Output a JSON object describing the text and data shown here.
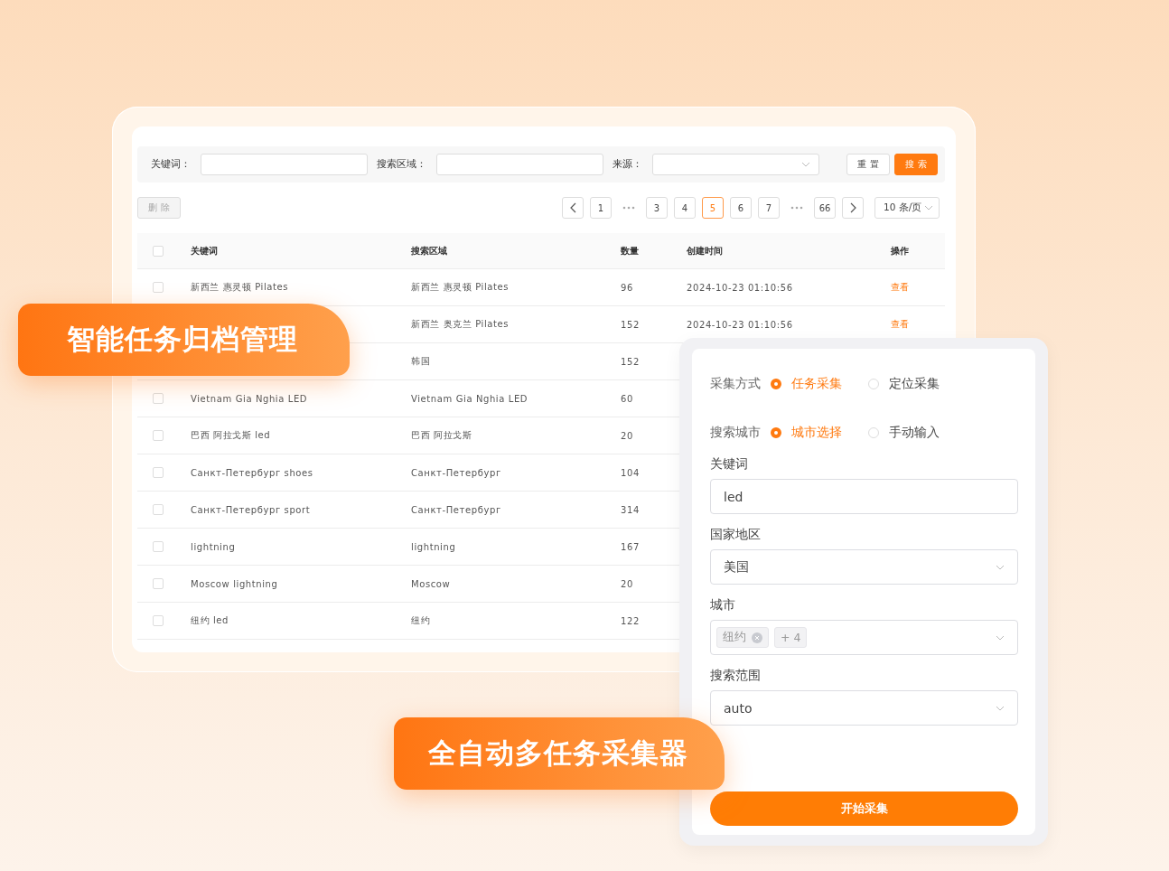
{
  "filters": [
    {
      "label": "关键词：",
      "kind": "input"
    },
    {
      "label": "搜索区域：",
      "kind": "input"
    },
    {
      "label": "来源：",
      "kind": "select"
    }
  ],
  "filter_buttons": [
    {
      "label": "重 置",
      "kind": "default"
    },
    {
      "label": "搜 索",
      "kind": "primary"
    }
  ],
  "delete_button": {
    "label": "删 除",
    "disabled": true
  },
  "pagination": {
    "items": [
      {
        "kind": "prev"
      },
      {
        "kind": "page",
        "label": "1",
        "selected": false
      },
      {
        "kind": "ellipsis"
      },
      {
        "kind": "page",
        "label": "3",
        "selected": false
      },
      {
        "kind": "page",
        "label": "4",
        "selected": false
      },
      {
        "kind": "page",
        "label": "5",
        "selected": true
      },
      {
        "kind": "page",
        "label": "6",
        "selected": false
      },
      {
        "kind": "page",
        "label": "7",
        "selected": false
      },
      {
        "kind": "ellipsis"
      },
      {
        "kind": "page",
        "label": "66",
        "selected": false
      },
      {
        "kind": "next"
      }
    ],
    "page_size": "10 条/页"
  },
  "table": {
    "header_checked": false,
    "columns": [
      "关键词",
      "搜索区域",
      "数量",
      "创建时间",
      "操作"
    ],
    "rows": [
      {
        "checked": false,
        "keyword": "新西兰 惠灵顿 Pilates",
        "area": "新西兰 惠灵顿 Pilates",
        "count": "96",
        "time": "2024-10-23 01:10:56",
        "action": "查看"
      },
      {
        "area": "新西兰 奥克兰 Pilates",
        "count": "152",
        "time": "2024-10-23 01:10:56",
        "action": "查看"
      },
      {
        "area": "韩国",
        "count": "152"
      },
      {
        "checked": false,
        "keyword": "Vietnam Gia Nghia LED",
        "area": "Vietnam Gia Nghia LED",
        "count": "60"
      },
      {
        "checked": false,
        "keyword": "巴西 阿拉戈斯 led",
        "area": "巴西 阿拉戈斯",
        "count": "20"
      },
      {
        "checked": false,
        "keyword": "Санкт-Петербург shoes",
        "area": "Санкт-Петербург",
        "count": "104"
      },
      {
        "checked": false,
        "keyword": "Санкт-Петербург sport",
        "area": "Санкт-Петербург",
        "count": "314"
      },
      {
        "checked": false,
        "keyword": "lightning",
        "area": "lightning",
        "count": "167"
      },
      {
        "checked": false,
        "keyword": "Moscow lightning",
        "area": "Moscow",
        "count": "20"
      },
      {
        "checked": false,
        "keyword": "纽约 led",
        "area": "纽约",
        "count": "122"
      }
    ]
  },
  "form": {
    "radio_groups": [
      {
        "label": "采集方式",
        "options": [
          {
            "label": "任务采集",
            "selected": true
          },
          {
            "label": "定位采集",
            "selected": false
          }
        ]
      },
      {
        "label": "搜索城市",
        "options": [
          {
            "label": "城市选择",
            "selected": true
          },
          {
            "label": "手动输入",
            "selected": false
          }
        ]
      }
    ],
    "fields": [
      {
        "kind": "input",
        "label": "关键词",
        "value": "led"
      },
      {
        "kind": "select",
        "label": "国家地区",
        "value": "美国"
      },
      {
        "kind": "tags",
        "label": "城市",
        "tags": [
          {
            "label": "纽约",
            "closable": true
          },
          {
            "label": "+ 4",
            "closable": false
          }
        ]
      },
      {
        "kind": "select",
        "label": "搜索范围",
        "value": "auto"
      }
    ],
    "submit": "开始采集"
  },
  "banners": [
    {
      "text": "智能任务归档管理"
    },
    {
      "text": "全自动多任务采集器"
    }
  ]
}
